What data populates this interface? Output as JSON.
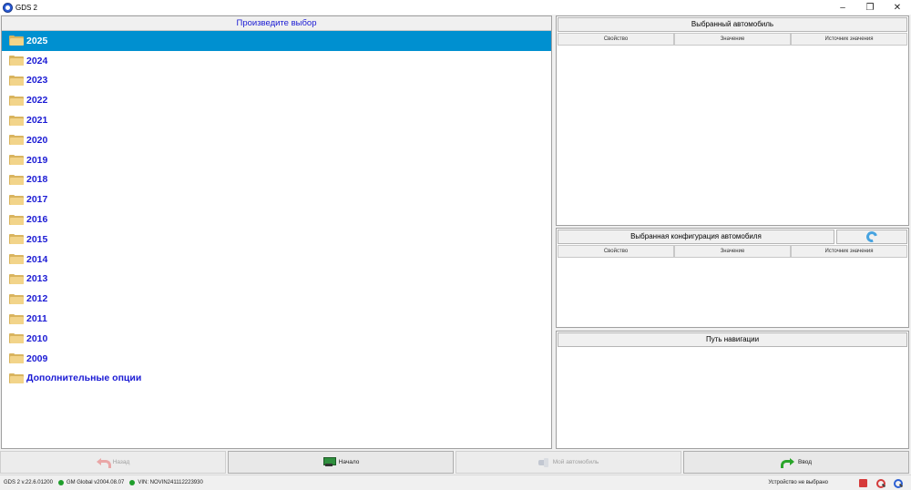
{
  "window": {
    "title": "GDS 2",
    "minimize": "–",
    "maximize": "❐",
    "close": "✕"
  },
  "left": {
    "header": "Произведите выбор",
    "items": [
      {
        "label": "2025",
        "selected": true
      },
      {
        "label": "2024"
      },
      {
        "label": "2023"
      },
      {
        "label": "2022"
      },
      {
        "label": "2021"
      },
      {
        "label": "2020"
      },
      {
        "label": "2019"
      },
      {
        "label": "2018"
      },
      {
        "label": "2017"
      },
      {
        "label": "2016"
      },
      {
        "label": "2015"
      },
      {
        "label": "2014"
      },
      {
        "label": "2013"
      },
      {
        "label": "2012"
      },
      {
        "label": "2011"
      },
      {
        "label": "2010"
      },
      {
        "label": "2009"
      },
      {
        "label": "Дополнительные опции"
      }
    ]
  },
  "selected_vehicle": {
    "header": "Выбранный автомобиль",
    "columns": [
      "Свойство",
      "Значение",
      "Источник значения"
    ]
  },
  "selected_config": {
    "header": "Выбранная конфигурация автомобиля",
    "columns": [
      "Свойство",
      "Значение",
      "Источник значения"
    ]
  },
  "nav_path": {
    "header": "Путь навигации"
  },
  "buttons": {
    "back": "Назад",
    "home": "Начало",
    "my_vehicle": "Мой автомобиль",
    "enter": "Ввод"
  },
  "status": {
    "version": "GDS 2 v.22.6.01200",
    "gm_global": "GM Global v2004.08.07",
    "vin": "VIN: NOVIN241112223930",
    "device": "Устройство не выбрано"
  },
  "colors": {
    "selection": "#0090d0",
    "item_text": "#1b1bd4",
    "status_dot": "#1f9e2b"
  }
}
